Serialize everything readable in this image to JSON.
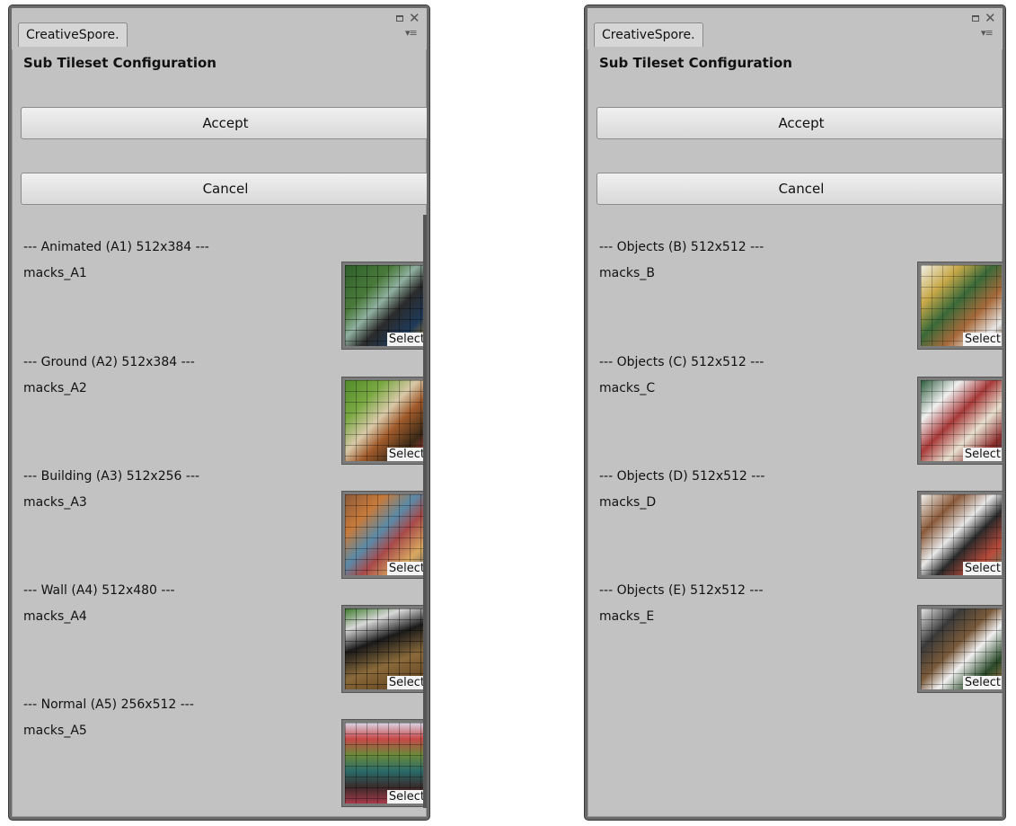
{
  "panels": [
    {
      "tab_title": "CreativeSpore.",
      "heading": "Sub Tileset Configuration",
      "accept_label": "Accept",
      "cancel_label": "Cancel",
      "entries": [
        {
          "section": "--- Animated (A1) 512x384 ---",
          "name": "macks_A1",
          "select_label": "Select"
        },
        {
          "section": "--- Ground (A2) 512x384 ---",
          "name": "macks_A2",
          "select_label": "Select"
        },
        {
          "section": "--- Building (A3) 512x256 ---",
          "name": "macks_A3",
          "select_label": "Select"
        },
        {
          "section": "--- Wall (A4) 512x480 ---",
          "name": "macks_A4",
          "select_label": "Select"
        },
        {
          "section": "--- Normal (A5) 256x512 ---",
          "name": "macks_A5",
          "select_label": "Select"
        }
      ]
    },
    {
      "tab_title": "CreativeSpore.",
      "heading": "Sub Tileset Configuration",
      "accept_label": "Accept",
      "cancel_label": "Cancel",
      "entries": [
        {
          "section": "--- Objects (B) 512x512 ---",
          "name": "macks_B",
          "select_label": "Select"
        },
        {
          "section": "--- Objects (C) 512x512 ---",
          "name": "macks_C",
          "select_label": "Select"
        },
        {
          "section": "--- Objects (D) 512x512 ---",
          "name": "macks_D",
          "select_label": "Select"
        },
        {
          "section": "--- Objects (E) 512x512 ---",
          "name": "macks_E",
          "select_label": "Select"
        }
      ]
    }
  ],
  "icons": [
    "maximize-icon",
    "close-icon",
    "panel-menu-icon"
  ]
}
